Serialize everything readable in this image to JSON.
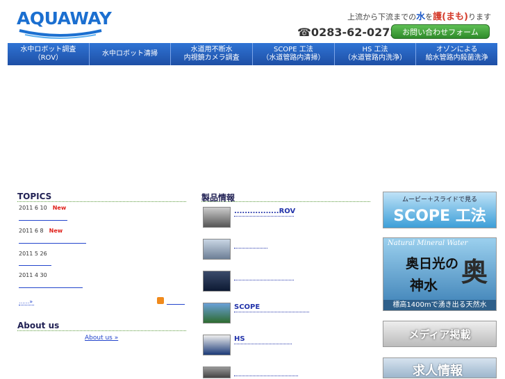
{
  "header": {
    "logo": "AQUAWAY",
    "tagline": {
      "pre": "上流から下流までの",
      "water": "水",
      "mid": "を",
      "protect": "護(まも)",
      "post": "ります"
    },
    "phone": "☎0283-62-0272",
    "contact_button": "お問い合わせフォーム"
  },
  "nav": {
    "items": [
      {
        "label": "水中ロボット調査\n（ROV）"
      },
      {
        "label": "水中ロボット清掃"
      },
      {
        "label": "水道用不断水\n内視鏡カメラ調査"
      },
      {
        "label": "SCOPE 工法\n（水道管路内清掃）"
      },
      {
        "label": "HS 工法\n（水道管路内洗浄）"
      },
      {
        "label": "オゾンによる\n給水管路内殺菌洗浄"
      }
    ]
  },
  "topics": {
    "title": "TOPICS",
    "items": [
      {
        "date": "2011 6 10",
        "badge": "New"
      },
      {
        "date": "2011 6 8",
        "badge": "New"
      },
      {
        "date": "2011 5 26",
        "badge": ""
      },
      {
        "date": "2011 4 30",
        "badge": ""
      }
    ],
    "more": "......»"
  },
  "about": {
    "title": "About us",
    "link": "About us »"
  },
  "products": {
    "title": "製品情報",
    "items": [
      {
        "label": ".................ROV"
      },
      {
        "label": ""
      },
      {
        "label": ""
      },
      {
        "label": "SCOPE"
      },
      {
        "label": "HS"
      },
      {
        "label": ""
      }
    ]
  },
  "banners": {
    "scope": {
      "top": "ムービー＋スライドで見る",
      "main": "SCOPE 工法"
    },
    "water": {
      "en": "Natural Mineral Water",
      "line1": "奥日光の",
      "line2": "神水",
      "big": "奥",
      "bottom": "標高1400mで湧き出る天然水"
    },
    "media": "メディア掲載",
    "job": "求人情報"
  }
}
